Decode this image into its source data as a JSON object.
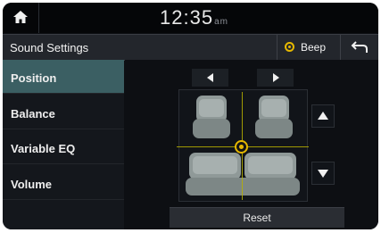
{
  "topbar": {
    "time": "12:35",
    "ampm": "am"
  },
  "header": {
    "title": "Sound Settings",
    "beep_label": "Beep"
  },
  "sidebar": {
    "items": [
      {
        "label": "Position",
        "active": true
      },
      {
        "label": "Balance",
        "active": false
      },
      {
        "label": "Variable EQ",
        "active": false
      },
      {
        "label": "Volume",
        "active": false
      }
    ]
  },
  "main": {
    "reset_label": "Reset"
  },
  "colors": {
    "accent": "#e6b800",
    "active_bg": "#3b5f63",
    "background": "#0d0f13"
  },
  "icons": [
    "home-icon",
    "back-icon",
    "arrow-left-icon",
    "arrow-right-icon",
    "arrow-up-icon",
    "arrow-down-icon"
  ]
}
